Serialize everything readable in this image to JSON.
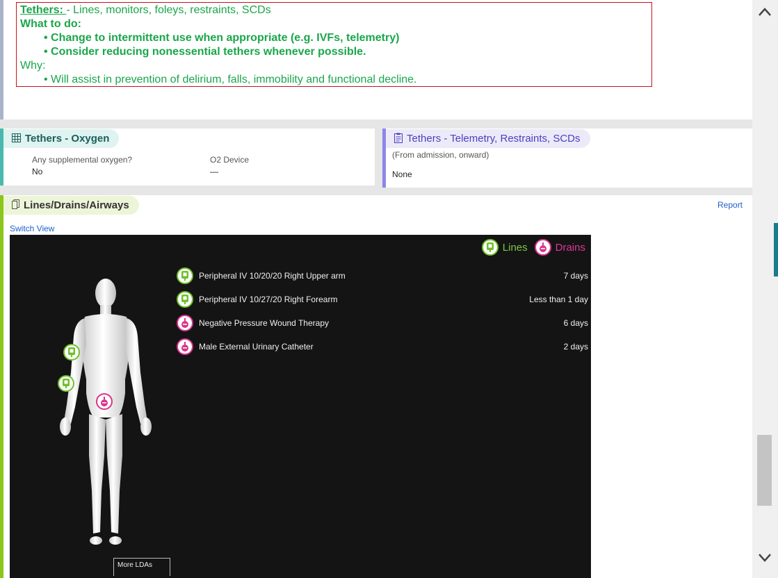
{
  "tethers_note": {
    "title": "Tethers: ",
    "title_suffix": "- Lines, monitors, foleys, restraints, SCDs",
    "what_to_do_label": "What to do:",
    "what_to_do_items": [
      "Change to intermittent use when appropriate (e.g. IVFs, telemetry)",
      "Consider reducing nonessential tethers whenever possible."
    ],
    "why_label": "Why:",
    "why_items": [
      "Will assist in prevention of delirium, falls, immobility and functional decline."
    ],
    "colors": {
      "text": "#1aa64a",
      "border": "#c8101e"
    }
  },
  "oxygen_panel": {
    "icon": "table-icon",
    "title": "Tethers - Oxygen",
    "question_1": "Any supplemental oxygen?",
    "answer_1": "No",
    "question_2": "O2 Device",
    "answer_2": "—",
    "accent": "#4ab9ad"
  },
  "telemetry_panel": {
    "icon": "clipboard-icon",
    "title": "Tethers - Telemetry, Restraints, SCDs",
    "subtitle": "(From admission, onward)",
    "value": "None",
    "accent": "#8c87e6"
  },
  "lda_panel": {
    "icon": "documents-icon",
    "title": "Lines/Drains/Airways",
    "report_link": "Report",
    "switch_view_link": "Switch View",
    "legend": {
      "lines": "Lines",
      "drains": "Drains"
    },
    "items": [
      {
        "type": "line",
        "icon": "iv-bag-icon",
        "name": "Peripheral IV 10/20/20 Right Upper arm",
        "duration": "7 days"
      },
      {
        "type": "line",
        "icon": "iv-bag-icon",
        "name": "Peripheral IV 10/27/20 Right Forearm",
        "duration": "Less than 1 day"
      },
      {
        "type": "drain",
        "icon": "drain-bulb-icon",
        "name": "Negative Pressure Wound Therapy",
        "duration": "6 days"
      },
      {
        "type": "drain",
        "icon": "drain-bulb-icon",
        "name": "Male External Urinary Catheter",
        "duration": "2 days"
      }
    ],
    "more_ldas": "More LDAs",
    "colors": {
      "line": "#6fbf2c",
      "drain": "#d9338e",
      "viewer_bg": "#141414",
      "accent": "#8bc61a"
    }
  }
}
